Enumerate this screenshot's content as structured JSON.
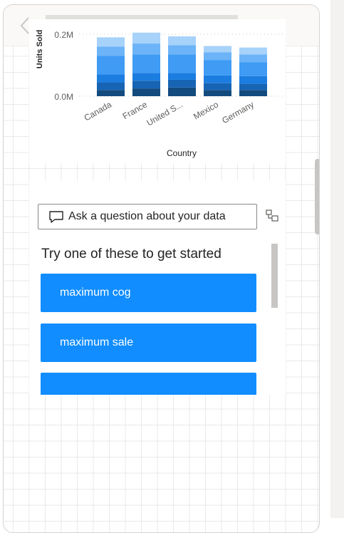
{
  "chart_data": {
    "type": "bar",
    "stacked": true,
    "ylabel": "Units Sold",
    "xlabel": "Country",
    "ylim": [
      0,
      0.2
    ],
    "y_ticks": [
      "0.0M",
      "0.2M"
    ],
    "categories": [
      "Canada",
      "France",
      "United S...",
      "Mexico",
      "Germany"
    ],
    "series": [
      {
        "color": "#134b7f",
        "values": [
          0.02,
          0.025,
          0.028,
          0.02,
          0.02
        ]
      },
      {
        "color": "#1764b4",
        "values": [
          0.025,
          0.025,
          0.025,
          0.022,
          0.02
        ]
      },
      {
        "color": "#1b7de0",
        "values": [
          0.025,
          0.025,
          0.022,
          0.025,
          0.025
        ]
      },
      {
        "color": "#3f9bf4",
        "values": [
          0.06,
          0.06,
          0.06,
          0.05,
          0.045
        ]
      },
      {
        "color": "#6cb4f7",
        "values": [
          0.03,
          0.035,
          0.03,
          0.025,
          0.025
        ]
      },
      {
        "color": "#a7d2fa",
        "values": [
          0.03,
          0.035,
          0.028,
          0.02,
          0.022
        ]
      }
    ],
    "grid": false,
    "legend": "none"
  },
  "qa": {
    "placeholder": "Ask a question about your data",
    "chat_icon": "chat-bubble-icon",
    "expand_icon": "expand-qa-icon",
    "suggest_title": "Try one of these to get started",
    "suggestions": [
      "maximum cog",
      "maximum sale",
      ""
    ],
    "accent": "#118dff"
  },
  "nav": {
    "back_icon": "chevron-left-icon"
  }
}
